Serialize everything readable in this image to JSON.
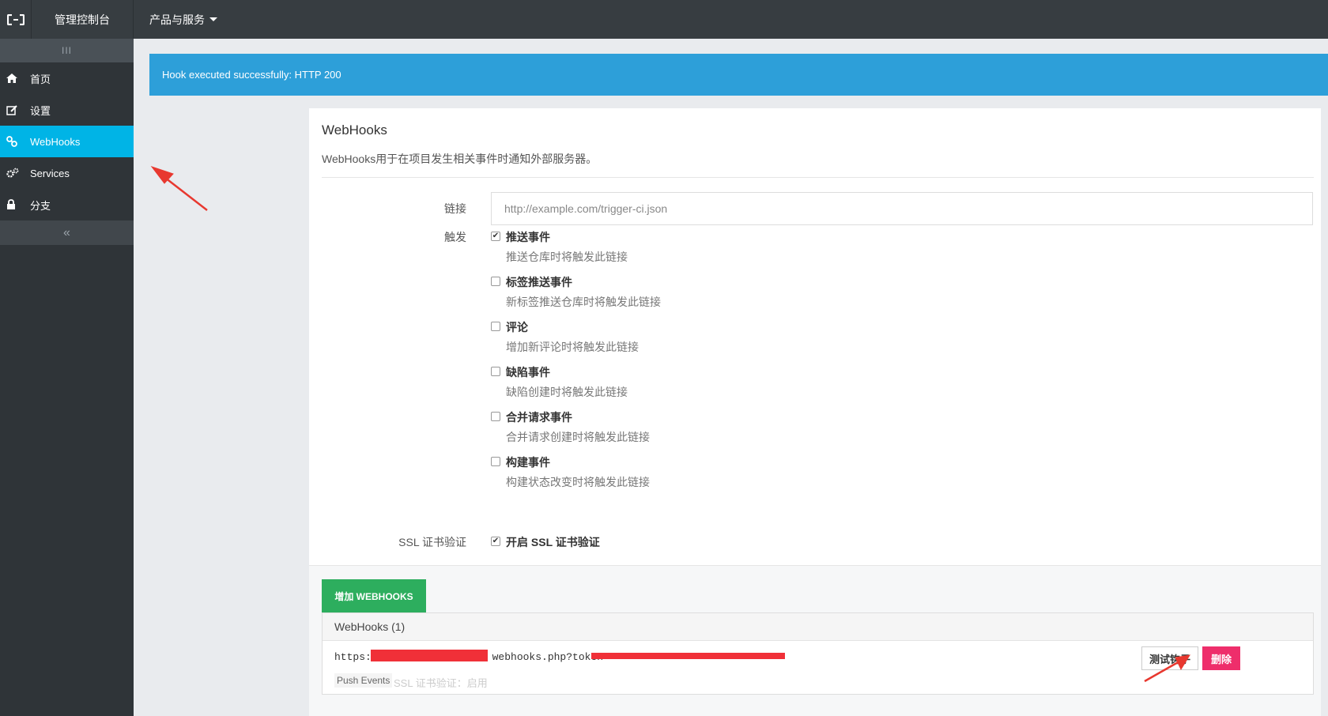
{
  "topbar": {
    "logo_icon": "aliyun-logo-icon",
    "console_label": "管理控制台",
    "products_label": "产品与服务"
  },
  "sidebar": {
    "toggle_label": "III",
    "collapse_label": "«",
    "items": [
      {
        "label": "首页",
        "icon": "home-icon",
        "active": false
      },
      {
        "label": "设置",
        "icon": "edit-icon",
        "active": false
      },
      {
        "label": "WebHooks",
        "icon": "link-icon",
        "active": true
      },
      {
        "label": "Services",
        "icon": "gears-icon",
        "active": false
      },
      {
        "label": "分支",
        "icon": "lock-icon",
        "active": false
      }
    ]
  },
  "alert": {
    "message": "Hook executed successfully: HTTP 200"
  },
  "panel": {
    "title": "WebHooks",
    "description": "WebHooks用于在项目发生相关事件时通知外部服务器。",
    "url_label": "链接",
    "url_placeholder": "http://example.com/trigger-ci.json",
    "trigger_label": "触发",
    "triggers": [
      {
        "title": "推送事件",
        "desc": "推送仓库时将触发此链接",
        "checked": true
      },
      {
        "title": "标签推送事件",
        "desc": "新标签推送仓库时将触发此链接",
        "checked": false
      },
      {
        "title": "评论",
        "desc": "增加新评论时将触发此链接",
        "checked": false
      },
      {
        "title": "缺陷事件",
        "desc": "缺陷创建时将触发此链接",
        "checked": false
      },
      {
        "title": "合并请求事件",
        "desc": "合并请求创建时将触发此链接",
        "checked": false
      },
      {
        "title": "构建事件",
        "desc": "构建状态改变时将触发此链接",
        "checked": false
      }
    ],
    "ssl_label": "SSL 证书验证",
    "ssl_option": "开启 SSL 证书验证",
    "ssl_checked": true,
    "add_button": "增加 WEBHOOKS"
  },
  "hooks_list": {
    "header": "WebHooks (1)",
    "items": [
      {
        "url_start": "https:/",
        "url_middle": "webhooks.php?token=",
        "tag": "Push Events",
        "ssl_info": "SSL 证书验证：启用",
        "test_button": "测试钩子",
        "delete_button": "删除"
      }
    ]
  },
  "colors": {
    "topbar": "#373d41",
    "sidebar": "#2f3438",
    "active": "#00b4e6",
    "alert": "#2d9fd9",
    "add_button": "#2dae5e",
    "delete_button": "#ee2e6b",
    "annotation_arrow": "#e8382f"
  }
}
